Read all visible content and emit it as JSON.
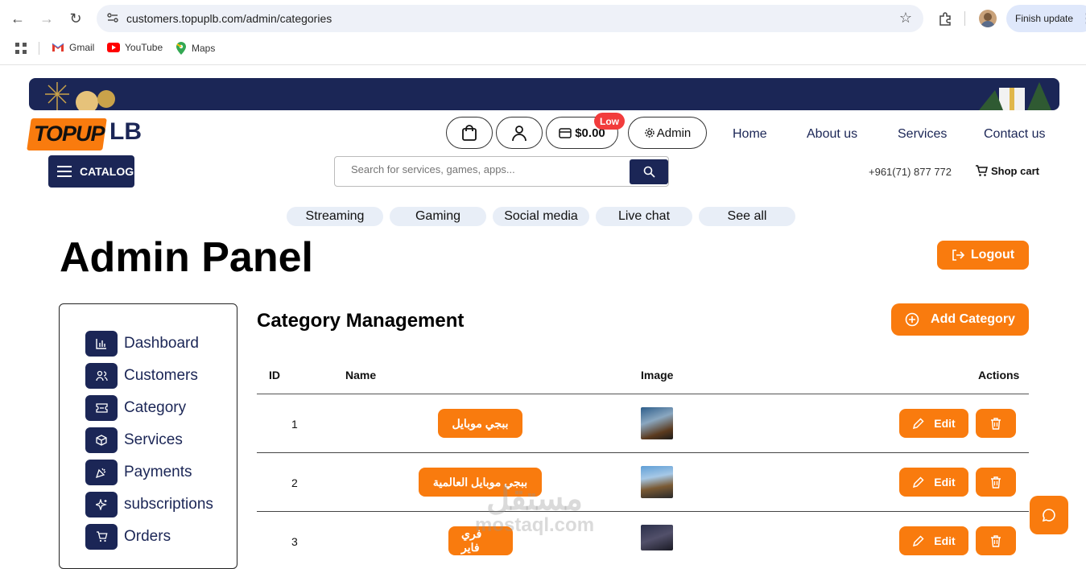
{
  "browser": {
    "url": "customers.topuplb.com/admin/categories",
    "finish_update": "Finish update",
    "bookmarks": [
      {
        "label": "Gmail",
        "icon": "gmail-icon"
      },
      {
        "label": "YouTube",
        "icon": "youtube-icon"
      },
      {
        "label": "Maps",
        "icon": "maps-icon"
      }
    ]
  },
  "header": {
    "logo_left": "TOPUP",
    "logo_right": "LB",
    "wallet_amount": "$0.00",
    "low_badge": "Low",
    "admin_label": "Admin",
    "nav": [
      "Home",
      "About us",
      "Services",
      "Contact us"
    ],
    "catalog_label": "CATALOG",
    "search_placeholder": "Search for services, games, apps...",
    "phone": "+961(71) 877 772",
    "shop_cart": "Shop cart",
    "categories": [
      "Streaming",
      "Gaming",
      "Social media",
      "Live chat",
      "See all"
    ]
  },
  "page": {
    "title": "Admin Panel",
    "logout_label": "Logout"
  },
  "sidebar": {
    "items": [
      {
        "label": "Dashboard",
        "icon": "bar-chart-icon"
      },
      {
        "label": "Customers",
        "icon": "users-icon"
      },
      {
        "label": "Category",
        "icon": "ticket-icon"
      },
      {
        "label": "Services",
        "icon": "box-icon"
      },
      {
        "label": "Payments",
        "icon": "party-popper-icon"
      },
      {
        "label": "subscriptions",
        "icon": "sparkles-icon"
      },
      {
        "label": "Orders",
        "icon": "cart-icon"
      }
    ]
  },
  "main": {
    "section_title": "Category Management",
    "add_label": "Add Category",
    "columns": [
      "ID",
      "Name",
      "Image",
      "Actions"
    ],
    "edit_label": "Edit",
    "rows": [
      {
        "id": "1",
        "name": "ببجي موبايل"
      },
      {
        "id": "2",
        "name": "ببجي موبايل العالمية"
      },
      {
        "id": "3",
        "name": "فري فاير"
      }
    ]
  },
  "watermark": {
    "arabic": "مستقل",
    "latin": "mostaql.com"
  },
  "colors": {
    "accent": "#f97b0e",
    "navy": "#1b2656"
  }
}
